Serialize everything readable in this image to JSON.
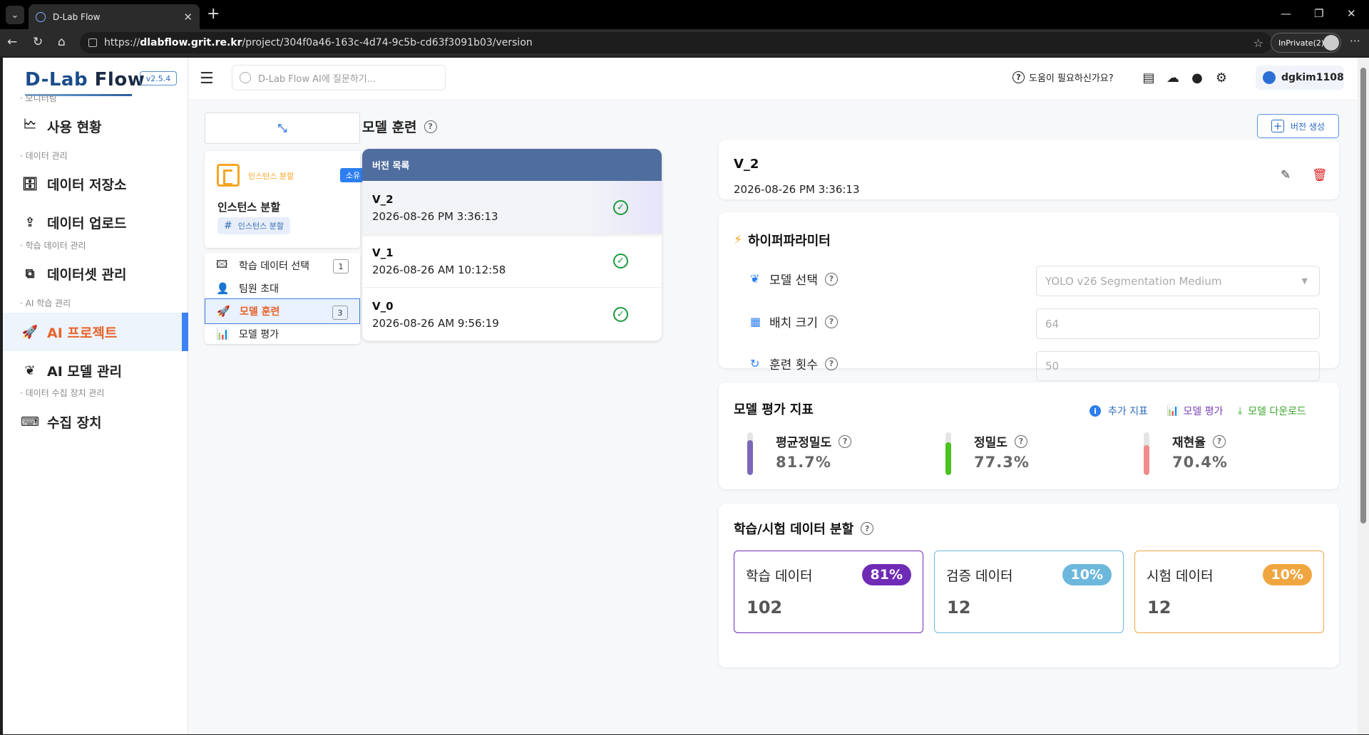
{
  "browser": {
    "tab_title": "D-Lab Flow",
    "url_prefix": "https://",
    "url_host": "dlabflow.grit.re.kr",
    "url_path": "/project/304f0a46-163c-4d74-9c5b-cd63f3091b03/version",
    "profile": "InPrivate(2)"
  },
  "sidebar": {
    "logo_main": "D-Lab",
    "logo_flow": "Flow",
    "version": "v2.5.4",
    "sections": {
      "monitoring": "· 모니터링",
      "data_mgmt": "· 데이터 관리",
      "train_data_mgmt": "· 학습 데이터 관리",
      "ai_train_mgmt": "· AI 학습 관리",
      "device_mgmt": "· 데이터 수집 장치 관리"
    },
    "items": {
      "usage": "사용 현황",
      "data_store": "데이터 저장소",
      "data_upload": "데이터 업로드",
      "dataset_mgmt": "데이터셋 관리",
      "ai_project": "AI 프로젝트",
      "ai_model_mgmt": "AI 모델 관리",
      "devices": "수집 장치"
    }
  },
  "topbar": {
    "search_placeholder": "D-Lab Flow AI에 질문하기...",
    "help": "도움이 필요하신가요?",
    "username": "dgkim1108"
  },
  "project": {
    "type": "인스턴스 분할",
    "owner_badge": "소유",
    "name": "인스턴스 분할",
    "tag": "인스턴스 분할",
    "steps": [
      {
        "label": "학습 데이터 선택",
        "count": "1"
      },
      {
        "label": "팀원 초대",
        "count": ""
      },
      {
        "label": "모델 훈련",
        "count": "3"
      },
      {
        "label": "모델 평가",
        "count": ""
      }
    ]
  },
  "training": {
    "title": "모델 훈련",
    "list_header": "버전 목록",
    "create_button": "버전 생성",
    "versions": [
      {
        "name": "V_2",
        "date": "2026-08-26 PM 3:36:13"
      },
      {
        "name": "V_1",
        "date": "2026-08-26 AM 10:12:58"
      },
      {
        "name": "V_0",
        "date": "2026-08-26 AM 9:56:19"
      }
    ]
  },
  "detail": {
    "name": "V_2",
    "date": "2026-08-26 PM 3:36:13"
  },
  "hyperparams": {
    "title": "하이퍼파라미터",
    "model_label": "모델 선택",
    "model_value": "YOLO v26 Segmentation Medium",
    "batch_label": "배치 크기",
    "batch_value": "64",
    "epochs_label": "훈련 횟수",
    "epochs_value": "50"
  },
  "metrics": {
    "title": "모델 평가 지표",
    "links": {
      "extra": "추가 지표",
      "eval": "모델 평가",
      "download": "모델 다운로드"
    },
    "items": [
      {
        "label": "평균정밀도",
        "value": "81.7%",
        "fraction": 0.817,
        "color": "#7b68b8"
      },
      {
        "label": "정밀도",
        "value": "77.3%",
        "fraction": 0.773,
        "color": "#4cc21f"
      },
      {
        "label": "재현율",
        "value": "70.4%",
        "fraction": 0.704,
        "color": "#f08c8c"
      }
    ]
  },
  "split": {
    "title": "학습/시험 데이터 분할",
    "items": [
      {
        "label": "학습 데이터",
        "pct": "81%",
        "count": "102",
        "color": "#6f2bb5"
      },
      {
        "label": "검증 데이터",
        "pct": "10%",
        "count": "12",
        "color": "#6cb8dc"
      },
      {
        "label": "시험 데이터",
        "pct": "10%",
        "count": "12",
        "color": "#f0a640"
      }
    ]
  },
  "colors": {
    "accent": "#e8632a",
    "primary": "#3b82f6",
    "list_header": "#4f6d9f",
    "success": "#1a9a3a",
    "danger": "#e02020"
  },
  "icons": [
    "monitor-icon",
    "archive-icon",
    "upload-icon",
    "dataset-icon",
    "rocket-icon",
    "brain-icon",
    "device-icon",
    "gear-icon",
    "flag-icon",
    "check-circle-icon",
    "edit-icon",
    "trash-icon",
    "bolt-icon",
    "help-icon"
  ]
}
